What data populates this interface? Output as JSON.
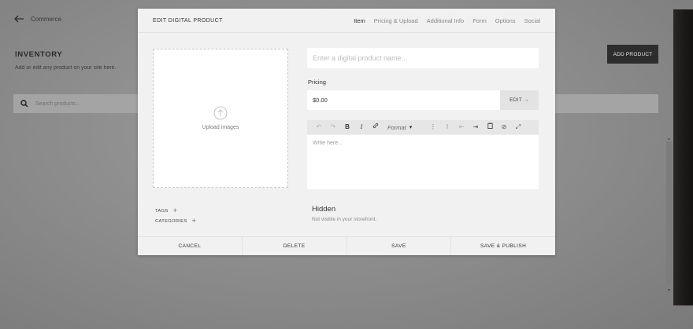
{
  "background": {
    "back_label": "Commerce",
    "title": "INVENTORY",
    "subtitle": "Add or edit any product on your site here.",
    "search_placeholder": "Search products...",
    "add_product_label": "ADD PRODUCT"
  },
  "modal": {
    "title": "EDIT DIGITAL PRODUCT",
    "tabs": [
      {
        "label": "Item",
        "active": true
      },
      {
        "label": "Pricing & Upload",
        "active": false
      },
      {
        "label": "Additional Info",
        "active": false
      },
      {
        "label": "Form",
        "active": false
      },
      {
        "label": "Options",
        "active": false
      },
      {
        "label": "Social",
        "active": false
      }
    ],
    "upload_label": "Upload images",
    "name_placeholder": "Enter a digital product name...",
    "pricing_label": "Pricing",
    "price_value": "$0.00",
    "edit_label": "EDIT →",
    "editor": {
      "format_label": "Format",
      "placeholder": "Write here..."
    },
    "tags_label": "TAGS",
    "categories_label": "CATEGORIES",
    "visibility_title": "Hidden",
    "visibility_subtitle": "Not visible in your storefront.",
    "footer": {
      "cancel": "CANCEL",
      "delete": "DELETE",
      "save": "SAVE",
      "save_publish": "SAVE & PUBLISH"
    }
  },
  "icons": {
    "back": "arrow-left-icon",
    "search": "search-icon",
    "upload": "arrow-up-circle-icon"
  },
  "colors": {
    "overlay": "#8c8c8c",
    "modal_bg": "#f1f1f1",
    "primary_button": "#2d2d2d"
  }
}
